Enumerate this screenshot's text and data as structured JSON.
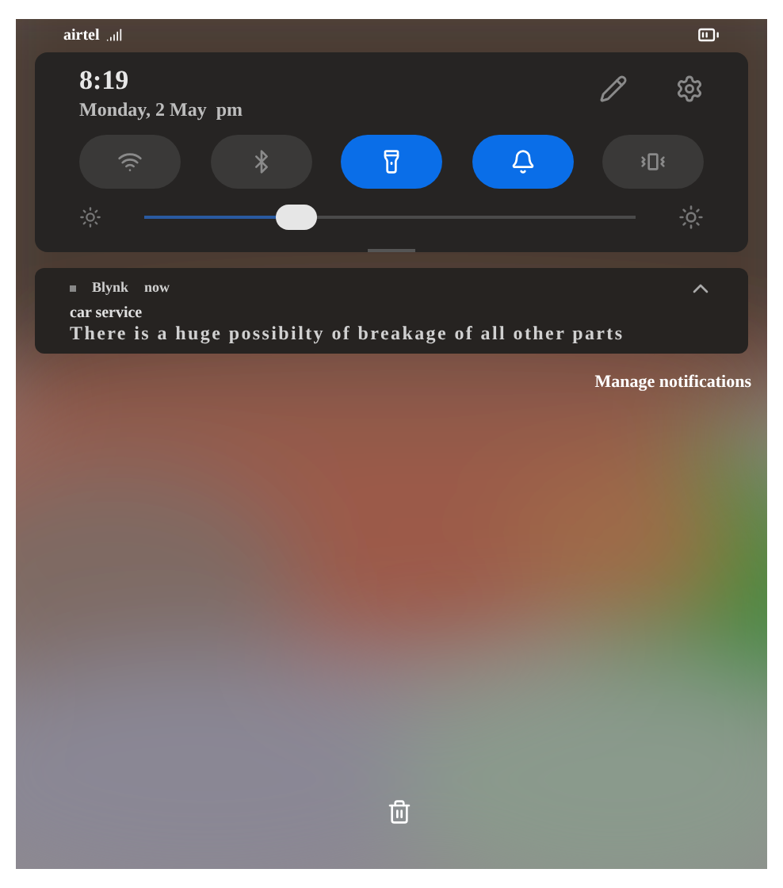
{
  "status_bar": {
    "carrier": "airtel"
  },
  "quick_panel": {
    "time": "8:19",
    "date": "Monday, 2 May  pm",
    "toggles": [
      {
        "on": false
      },
      {
        "on": false
      },
      {
        "on": true
      },
      {
        "on": true
      },
      {
        "on": false
      }
    ],
    "brightness": {
      "level": 0.31
    }
  },
  "notification": {
    "app": "Blynk",
    "time": "now",
    "title": "car service",
    "body": "There is a huge possibilty of breakage of all other parts"
  },
  "manage_link": "Manage notifications"
}
